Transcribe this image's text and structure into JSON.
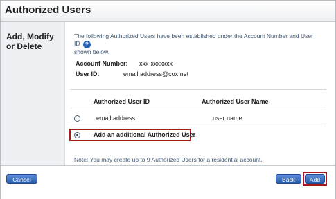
{
  "page": {
    "title": "Authorized Users"
  },
  "section": {
    "label": "Add, Modify or Delete"
  },
  "intro": {
    "text": "The following Authorized Users have been established under the Account Number and User ID",
    "text2": "shown below.",
    "help_icon": "?"
  },
  "account": {
    "account_number_label": "Account Number:",
    "account_number_value": "xxx-xxxxxxx",
    "user_id_label": "User ID:",
    "user_id_value": "email address@cox.net"
  },
  "table": {
    "columns": [
      "Authorized User ID",
      "Authorized User Name"
    ],
    "rows": [
      {
        "id": "email address",
        "name": "user name",
        "selected": false
      }
    ],
    "add_option": {
      "label": "Add an additional Authorized User",
      "selected": true
    }
  },
  "note": "Note: You may create up to 9 Authorized Users for a residential account.",
  "footer": {
    "cancel_label": "Cancel",
    "back_label": "Back",
    "add_label": "Add"
  },
  "colors": {
    "highlight": "#a8191c",
    "button": "#2a5cab",
    "sidebar": "#eef1f4"
  }
}
